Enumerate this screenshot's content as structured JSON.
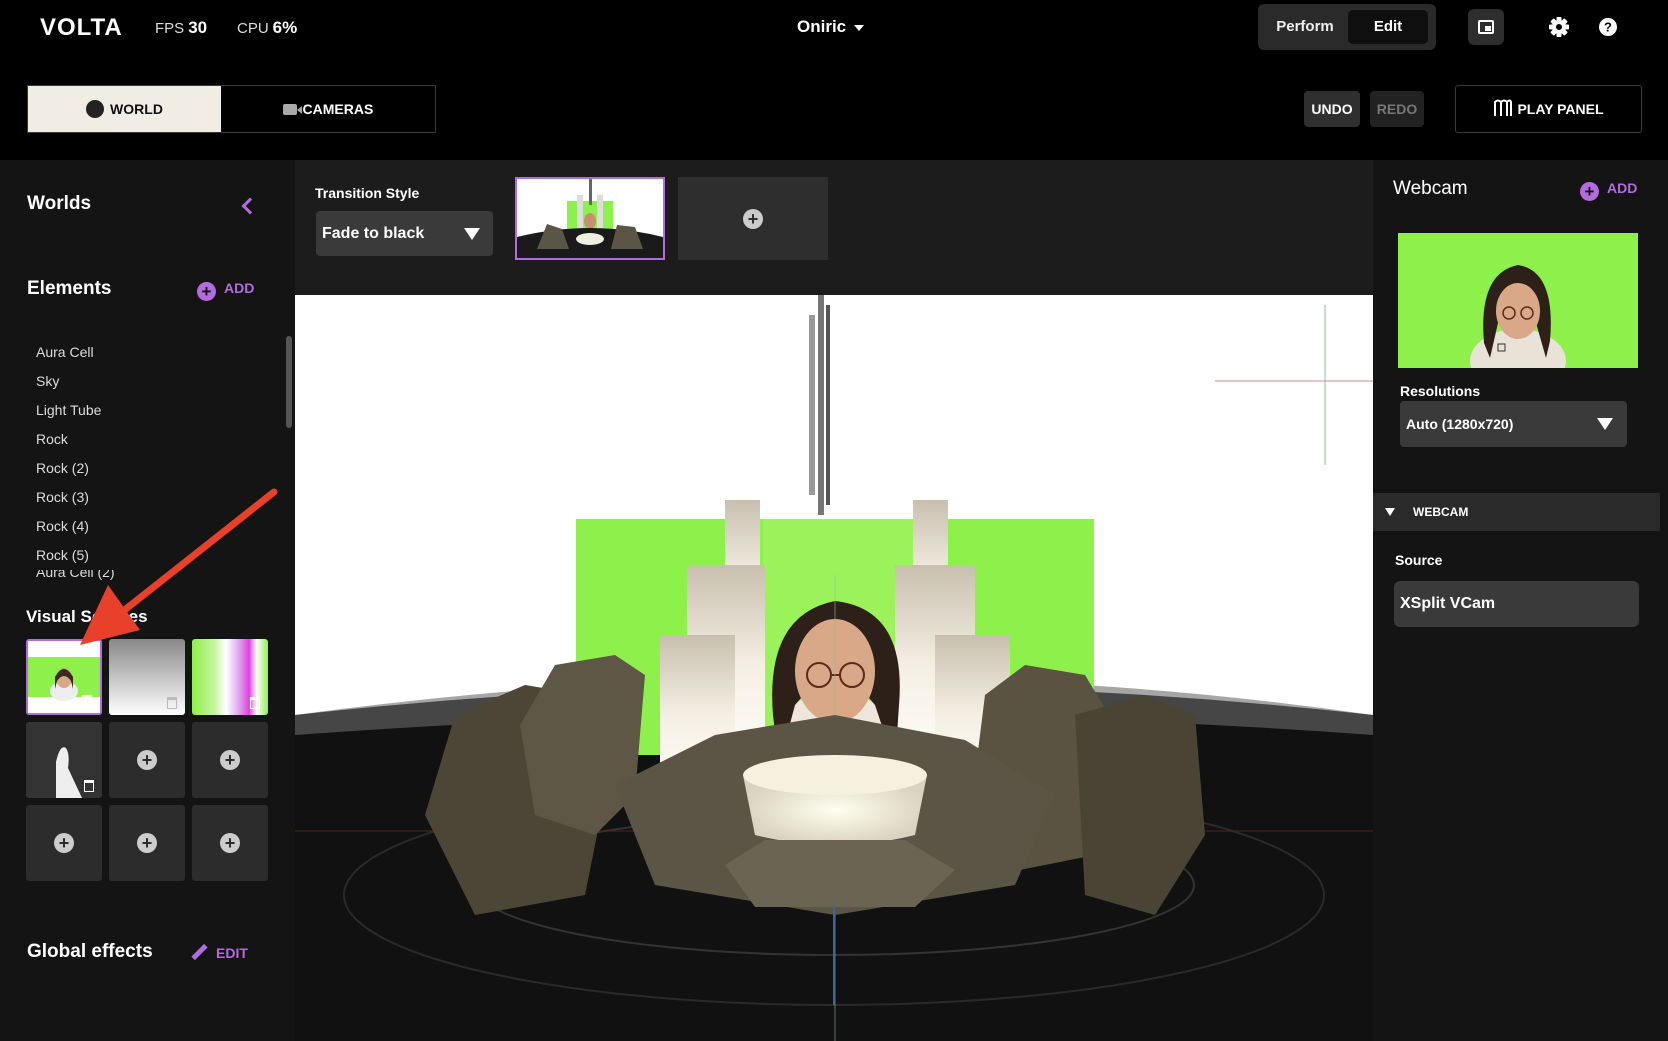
{
  "topbar": {
    "logo": "VOLTA",
    "fps_label": "FPS",
    "fps_value": "30",
    "cpu_label": "CPU",
    "cpu_value": "6%",
    "project_name": "Oniric",
    "mode_perform": "Perform",
    "mode_edit": "Edit",
    "active_mode": "Edit"
  },
  "tabs": {
    "world": "WORLD",
    "cameras": "CAMERAS",
    "active": "WORLD"
  },
  "actions": {
    "undo": "UNDO",
    "redo": "REDO",
    "play_panel": "PLAY PANEL"
  },
  "sidebar": {
    "worlds_title": "Worlds",
    "elements_title": "Elements",
    "elements_add": "ADD",
    "elements": [
      "Aura Cell",
      "Sky",
      "Light Tube",
      "Rock",
      "Rock (2)",
      "Rock (3)",
      "Rock (4)",
      "Rock (5)",
      "Aura Cell (2)"
    ],
    "visual_sources_title": "Visual Sources",
    "global_effects_title": "Global effects",
    "global_effects_edit": "EDIT"
  },
  "transition": {
    "label": "Transition Style",
    "value": "Fade to black"
  },
  "right_panel": {
    "title": "Webcam",
    "add": "ADD",
    "resolutions_label": "Resolutions",
    "resolution_value": "Auto (1280x720)",
    "section_label": "WEBCAM",
    "source_label": "Source",
    "source_value": "XSplit VCam"
  },
  "colors": {
    "accent": "#b36ce0",
    "green_screen": "#8ef04b",
    "annotation_arrow": "#e8402a"
  },
  "icons": [
    "pip-icon",
    "gear-icon",
    "help-icon",
    "globe-icon",
    "camera-icon",
    "play-panel-icon",
    "collapse-chevron-icon",
    "plus-circle-icon",
    "trash-icon",
    "pencil-icon",
    "dropdown-caret-icon"
  ]
}
